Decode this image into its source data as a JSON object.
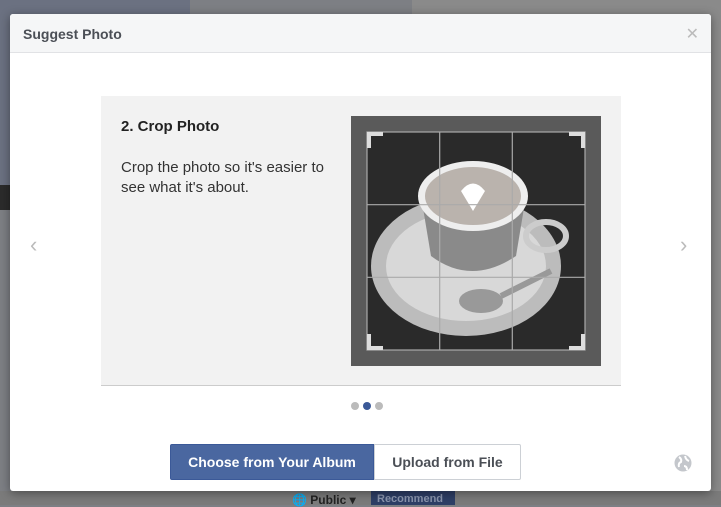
{
  "background": {
    "privacy_label": "Public",
    "recommend_label": "Recommend"
  },
  "dialog": {
    "title": "Suggest Photo",
    "close_icon": "close-icon",
    "step_title": "2. Crop Photo",
    "step_description": "Crop the photo so it's easier to see what it's about.",
    "pager": {
      "total": 3,
      "current": 2
    },
    "choose_album_label": "Choose from Your Album",
    "upload_file_label": "Upload from File",
    "accent_color": "#4a67a0"
  }
}
